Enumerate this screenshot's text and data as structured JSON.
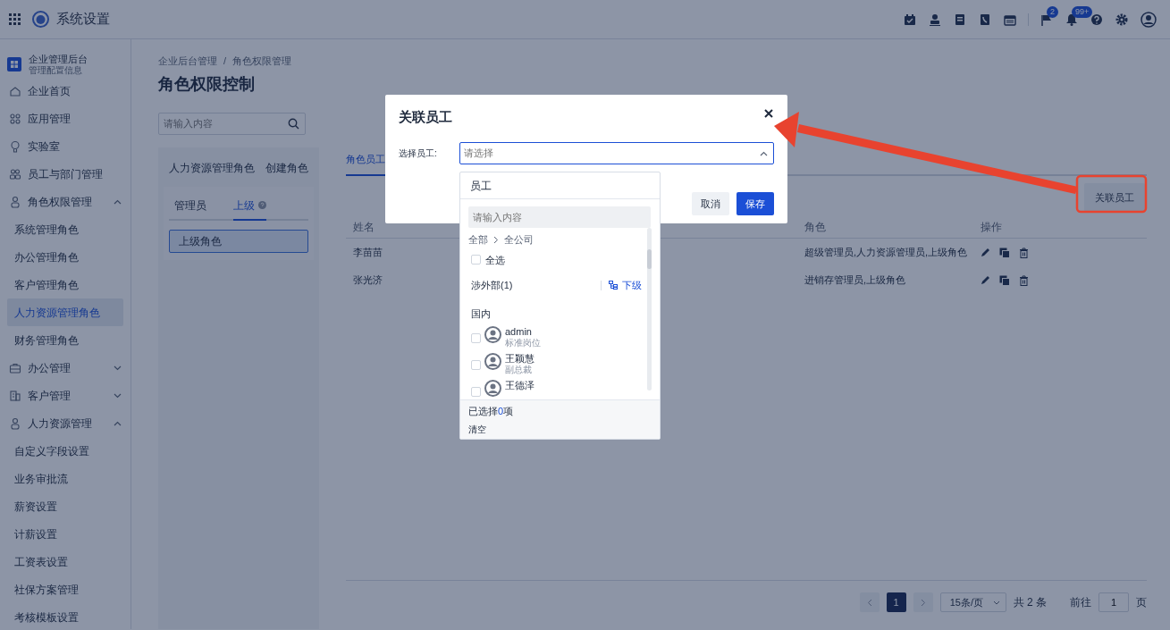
{
  "app": {
    "title": "系统设置"
  },
  "toolbar": {
    "badges": [
      "2",
      "99+"
    ]
  },
  "sidebar": {
    "org_title": "企业管理后台",
    "org_subtitle": "管理配置信息",
    "items": [
      {
        "label": "企业首页"
      },
      {
        "label": "应用管理"
      },
      {
        "label": "实验室"
      },
      {
        "label": "员工与部门管理"
      },
      {
        "label": "角色权限管理",
        "expanded": true,
        "children": [
          {
            "label": "系统管理角色",
            "selected": false
          },
          {
            "label": "办公管理角色",
            "selected": false
          },
          {
            "label": "客户管理角色",
            "selected": false
          },
          {
            "label": "人力资源管理角色",
            "selected": true
          },
          {
            "label": "财务管理角色",
            "selected": false
          }
        ]
      },
      {
        "label": "办公管理",
        "expanded": false
      },
      {
        "label": "客户管理",
        "expanded": false
      },
      {
        "label": "人力资源管理",
        "expanded": true,
        "children": [
          {
            "label": "自定义字段设置",
            "selected": false
          },
          {
            "label": "业务审批流",
            "selected": false
          },
          {
            "label": "薪资设置",
            "selected": false
          },
          {
            "label": "计薪设置",
            "selected": false
          },
          {
            "label": "工资表设置",
            "selected": false
          },
          {
            "label": "社保方案管理",
            "selected": false
          },
          {
            "label": "考核模板设置",
            "selected": false
          }
        ]
      }
    ]
  },
  "breadcrumb": [
    "企业后台管理",
    "角色权限管理"
  ],
  "breadcrumb_separator": "/",
  "page_title": "角色权限控制",
  "role_search": {
    "placeholder": "请输入内容"
  },
  "role_panel": {
    "title": "人力资源管理角色",
    "action": "创建角色",
    "tabs": [
      {
        "label": "管理员",
        "selected": false
      },
      {
        "label": "上级",
        "selected": true
      }
    ],
    "roles": [
      {
        "label": "上级角色",
        "selected": true
      }
    ]
  },
  "detail_tabs": [
    {
      "label": "角色员工",
      "selected": true
    }
  ],
  "link_button": "关联员工",
  "table": {
    "columns": [
      "姓名",
      "",
      "角色",
      "操作"
    ],
    "rows": [
      {
        "name": "李苗苗",
        "role": "超级管理员,人力资源管理员,上级角色"
      },
      {
        "name": "张光济",
        "role": "进销存管理员,上级角色"
      }
    ]
  },
  "pagination": {
    "pages": [
      {
        "label": "1",
        "selected": true
      }
    ],
    "page_size": "15条/页",
    "total": "共 2 条",
    "goto_label": "前往",
    "goto_value": "1",
    "goto_suffix": "页"
  },
  "modal": {
    "title": "关联员工",
    "field_label": "选择员工:",
    "placeholder": "请选择",
    "buttons": [
      {
        "label": "取消",
        "kind": "secondary"
      },
      {
        "label": "保存",
        "kind": "primary"
      }
    ]
  },
  "dropdown": {
    "header": "员工",
    "search_placeholder": "请输入内容",
    "path": [
      "全部",
      "全公司"
    ],
    "select_all": {
      "label": "全选",
      "checked": false
    },
    "department": {
      "name": "涉外部(1)",
      "action": "下级"
    },
    "group": "国内",
    "employees": [
      {
        "name": "admin",
        "title": "标准岗位",
        "checked": false
      },
      {
        "name": "王颖慧",
        "title": "副总裁",
        "checked": false
      },
      {
        "name": "王德泽",
        "checked": false
      }
    ],
    "selected_prefix": "已选择",
    "selected_count": "0",
    "selected_suffix": "项",
    "clear": "清空"
  }
}
